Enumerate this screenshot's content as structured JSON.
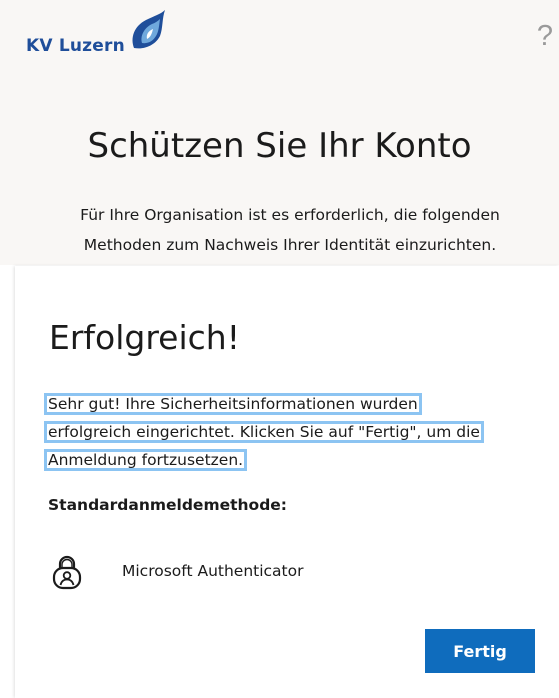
{
  "brand": {
    "logo_text": "KV Luzern",
    "logo_color": "#1f4e9a",
    "accent_color": "#0f6cbd"
  },
  "header": {
    "help_icon": "help-question-mark",
    "help_glyph": "?",
    "title": "Schützen Sie Ihr Konto",
    "description": "Für Ihre Organisation ist es erforderlich, die folgenden Methoden zum Nachweis Ihrer Identität einzurichten."
  },
  "card": {
    "title": "Erfolgreich!",
    "message_lines": [
      "Sehr gut! Ihre Sicherheitsinformationen wurden",
      "erfolgreich eingerichtet. Klicken Sie auf \"Fertig\", um die",
      "Anmeldung fortzusetzen."
    ],
    "default_method_label": "Standardanmeldemethode:",
    "method": {
      "icon": "authenticator-lock-icon",
      "name": "Microsoft Authenticator"
    },
    "done_label": "Fertig"
  }
}
